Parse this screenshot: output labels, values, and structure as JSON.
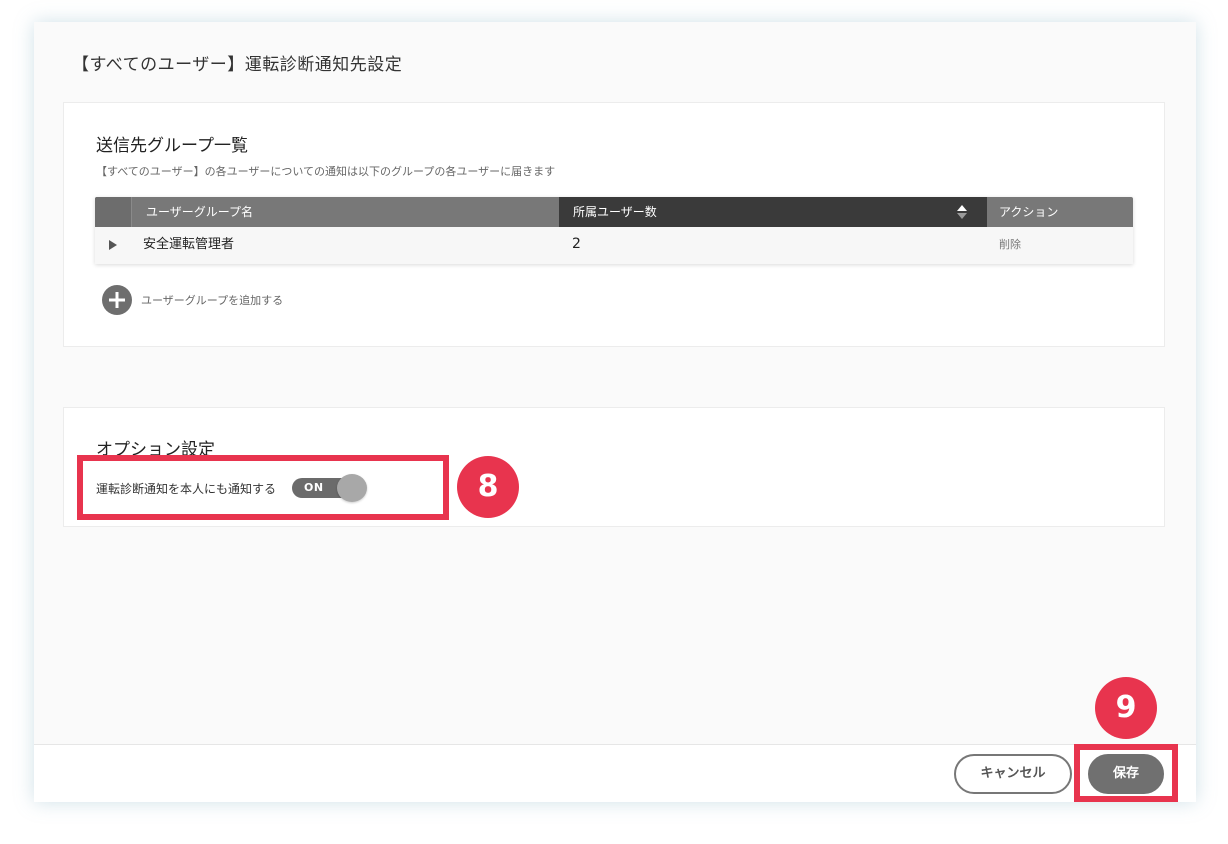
{
  "modal": {
    "title": "【すべてのユーザー】運転診断通知先設定"
  },
  "groups": {
    "heading": "送信先グループ一覧",
    "description": "【すべてのユーザー】の各ユーザーについての通知は以下のグループの各ユーザーに届きます",
    "table": {
      "columns": [
        "ユーザーグループ名",
        "所属ユーザー数",
        "アクション"
      ],
      "rows": [
        {
          "name": "安全運転管理者",
          "count": "2",
          "action": "削除"
        }
      ]
    },
    "add_label": "ユーザーグループを追加する"
  },
  "options": {
    "heading": "オプション設定",
    "notify_self_label": "運転診断通知を本人にも通知する",
    "toggle_state": "ON"
  },
  "footer": {
    "cancel_label": "キャンセル",
    "save_label": "保存"
  },
  "annotations": {
    "badge_8": "8",
    "badge_9": "9",
    "accent_color": "#e8344e"
  }
}
